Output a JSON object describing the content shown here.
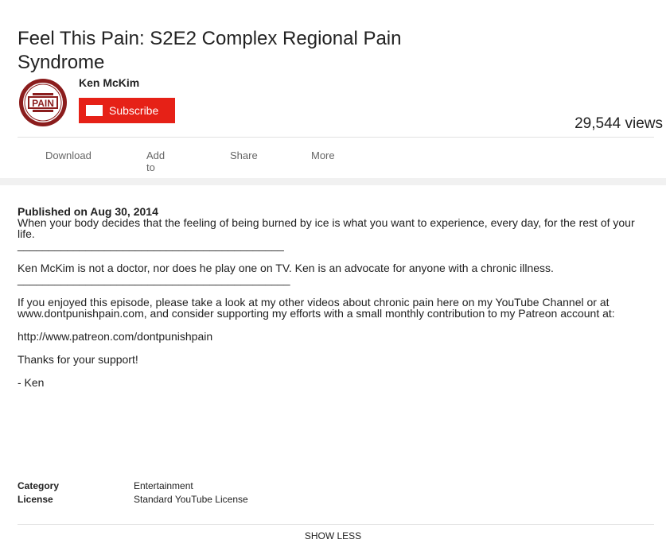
{
  "video": {
    "title": "Feel This Pain: S2E2 Complex Regional Pain Syndrome",
    "views": "29,544 views"
  },
  "channel": {
    "name": "Ken McKim",
    "subscribe_label": "Subscribe",
    "avatar_text": "PAIN"
  },
  "actions": {
    "download": "Download",
    "add_to": "Add to",
    "share": "Share",
    "more": "More"
  },
  "description": {
    "published": "Published on Aug 30, 2014",
    "p1": "When your body decides that the feeling of being burned by ice is what you want to experience, every day, for the rest of your life.",
    "sep1": "___________________________________________",
    "p2": "Ken McKim is not a doctor, nor does he play one on TV. Ken is an advocate for anyone with a chronic illness.",
    "sep2": "____________________________________________",
    "p3": "If you enjoyed this episode, please take a look at my other videos about chronic pain here on my YouTube Channel or at www.dontpunishpain.com, and consider supporting my efforts with a small monthly contribution to my Patreon account at:",
    "p4": "http://www.patreon.com/dontpunishpain",
    "p5": "Thanks for your support!",
    "p6": "- Ken"
  },
  "metadata": {
    "category_label": "Category",
    "category_value": "Entertainment",
    "license_label": "License",
    "license_value": "Standard YouTube License"
  },
  "show_less": "SHOW LESS",
  "colors": {
    "subscribe": "#e62117",
    "avatar_ring": "#8b1d1d"
  }
}
